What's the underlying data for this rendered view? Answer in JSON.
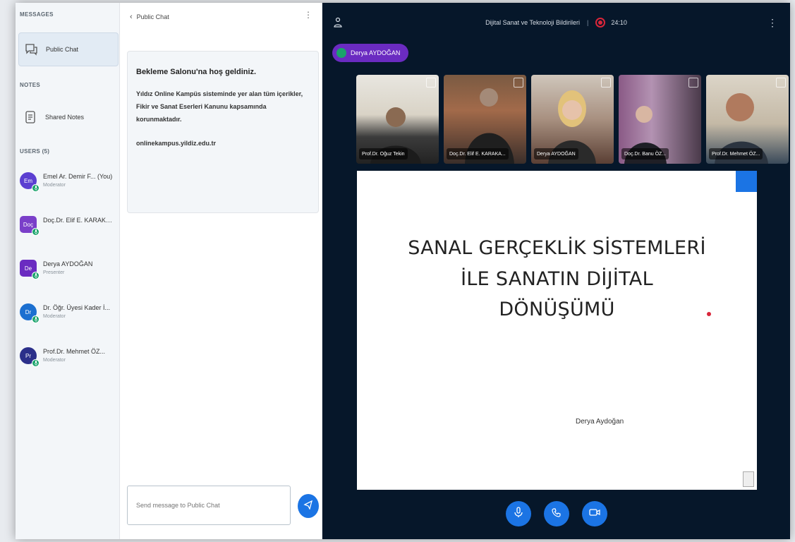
{
  "sidebar": {
    "messages_title": "MESSAGES",
    "public_chat_label": "Public Chat",
    "notes_title": "NOTES",
    "shared_notes_label": "Shared Notes",
    "users_title": "USERS (5)",
    "users": [
      {
        "initials": "Em",
        "name": "Emel Ar. Demir F... (You)",
        "role": "Moderator",
        "color": "#5b3fd1",
        "shape": "round"
      },
      {
        "initials": "Doç",
        "name": "Doç.Dr. Elif E. KARAKA...",
        "role": "",
        "color": "#7a3fc9",
        "shape": "square"
      },
      {
        "initials": "De",
        "name": "Derya AYDOĞAN",
        "role": "Presenter",
        "color": "#6a2bc1",
        "shape": "square"
      },
      {
        "initials": "Dr",
        "name": "Dr. Öğr. Üyesi Kader İ...",
        "role": "Moderator",
        "color": "#1b6fd0",
        "shape": "round"
      },
      {
        "initials": "Pr",
        "name": "Prof.Dr. Mehmet ÖZ...",
        "role": "Moderator",
        "color": "#2b2f8a",
        "shape": "round"
      }
    ]
  },
  "chat": {
    "title": "Public Chat",
    "welcome_title": "Bekleme Salonu'na hoş geldiniz.",
    "welcome_body": "Yıldız Online Kampüs sisteminde yer alan tüm içerikler, Fikir ve Sanat Eserleri Kanunu kapsamında korunmaktadır.",
    "welcome_link": "onlinekampus.yildiz.edu.tr",
    "input_placeholder": "Send message to Public Chat"
  },
  "meeting": {
    "title": "Dijital Sanat ve Teknoloji Bildirileri",
    "rec_time": "24:10",
    "talker": "Derya AYDOĞAN"
  },
  "videos": [
    {
      "caption": "Prof.Dr. Oğuz Tekin"
    },
    {
      "caption": "Doç.Dr. Elif E. KARAKA..."
    },
    {
      "caption": "Derya AYDOĞAN"
    },
    {
      "caption": "Doç.Dr. Banu ÖZ..."
    },
    {
      "caption": "Prof.Dr. Mehmet ÖZ..."
    }
  ],
  "slide": {
    "title_line1": "SANAL GERÇEKLİK SİSTEMLERİ",
    "title_line2": "İLE SANATIN DİJİTAL",
    "title_line3": "DÖNÜŞÜMÜ",
    "author": "Derya Aydoğan"
  },
  "colors": {
    "accent": "#1b74e4",
    "dark_bg": "#06172a",
    "talker_chip": "#6a2bc1",
    "recording": "#d9263a",
    "voice": "#1aa36b"
  }
}
